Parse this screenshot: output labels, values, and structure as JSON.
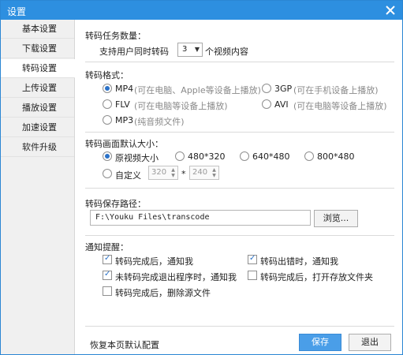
{
  "window": {
    "title": "设置"
  },
  "sidebar": {
    "items": [
      {
        "label": "基本设置"
      },
      {
        "label": "下载设置"
      },
      {
        "label": "转码设置"
      },
      {
        "label": "上传设置"
      },
      {
        "label": "播放设置"
      },
      {
        "label": "加速设置"
      },
      {
        "label": "软件升级"
      }
    ],
    "active_index": 2
  },
  "task_count": {
    "title": "转码任务数量：",
    "prefix": "支持用户同时转码",
    "value": "3",
    "suffix": "个视频内容"
  },
  "format": {
    "title": "转码格式：",
    "options": [
      {
        "name": "MP4",
        "desc": "(可在电脑、Apple等设备上播放)",
        "selected": true
      },
      {
        "name": "3GP",
        "desc": "(可在手机设备上播放)",
        "selected": false
      },
      {
        "name": "FLV",
        "desc": "(可在电脑等设备上播放)",
        "selected": false
      },
      {
        "name": "AVI",
        "desc": "(可在电脑等设备上播放)",
        "selected": false
      },
      {
        "name": "MP3",
        "desc": "(纯音频文件)",
        "selected": false
      }
    ]
  },
  "size": {
    "title": "转码画面默认大小：",
    "options": [
      {
        "label": "原视频大小",
        "selected": true
      },
      {
        "label": "480*320",
        "selected": false
      },
      {
        "label": "640*480",
        "selected": false
      },
      {
        "label": "800*480",
        "selected": false
      },
      {
        "label": "自定义",
        "selected": false
      }
    ],
    "custom_width": "320",
    "custom_sep": "*",
    "custom_height": "240"
  },
  "save_path": {
    "title": "转码保存路径：",
    "value": "F:\\Youku Files\\transcode",
    "browse_label": "浏览..."
  },
  "notify": {
    "title": "通知提醒：",
    "options": [
      {
        "label": "转码完成后，通知我",
        "checked": true
      },
      {
        "label": "转码出错时，通知我",
        "checked": true
      },
      {
        "label": "未转码完成退出程序时，通知我",
        "checked": true
      },
      {
        "label": "转码完成后，打开存放文件夹",
        "checked": false
      },
      {
        "label": "转码完成后，删除源文件",
        "checked": false
      }
    ]
  },
  "footer": {
    "restore_label": "恢复本页默认配置",
    "save_label": "保存",
    "exit_label": "退出"
  },
  "colors": {
    "titlebar": "#2d8fe0",
    "primary_button": "#4a9ee8",
    "accent": "#2b72c8"
  }
}
